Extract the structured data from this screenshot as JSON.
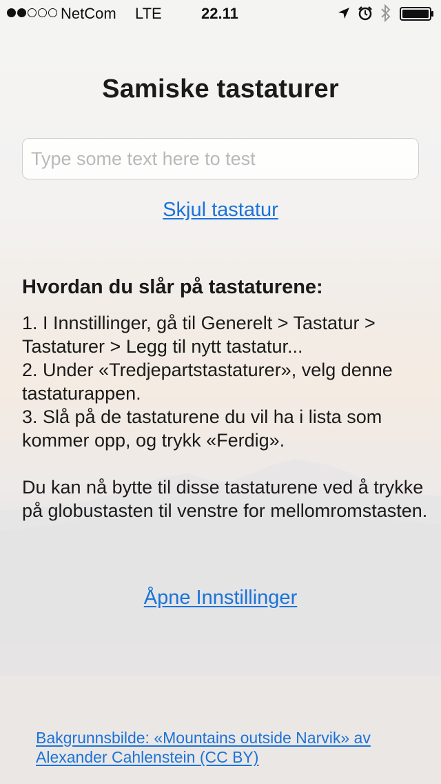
{
  "status_bar": {
    "signal_dots": [
      true,
      true,
      false,
      false,
      false
    ],
    "carrier": "NetCom",
    "network": "LTE",
    "time": "22.11",
    "icons": [
      "location-arrow-icon",
      "alarm-clock-icon",
      "bluetooth-icon",
      "battery-icon"
    ]
  },
  "title": "Samiske tastaturer",
  "test_input": {
    "value": "",
    "placeholder": "Type some text here to test"
  },
  "hide_keyboard_label": "Skjul tastatur",
  "instructions": {
    "heading": "Hvordan du slår på tastaturene:",
    "steps": [
      "1. I Innstillinger, gå til Generelt > Tastatur > Tastaturer > Legg til nytt tastatur...",
      "2. Under «Tredjepartstastaturer», velg denne tastaturappen.",
      "3. Slå på de tastaturene du vil ha i lista som kommer opp, og trykk «Ferdig»."
    ],
    "note": "Du kan nå bytte til disse tastaturene ved å trykke på globustasten til venstre for mellomromstasten."
  },
  "open_settings_label": "Åpne Innstillinger",
  "credit_label": "Bakgrunnsbilde: «Mountains outside Narvik» av Alexander Cahlenstein (CC BY)",
  "colors": {
    "link": "#1a73d9",
    "text": "#1a1a1a",
    "placeholder": "#b9b9b9"
  }
}
